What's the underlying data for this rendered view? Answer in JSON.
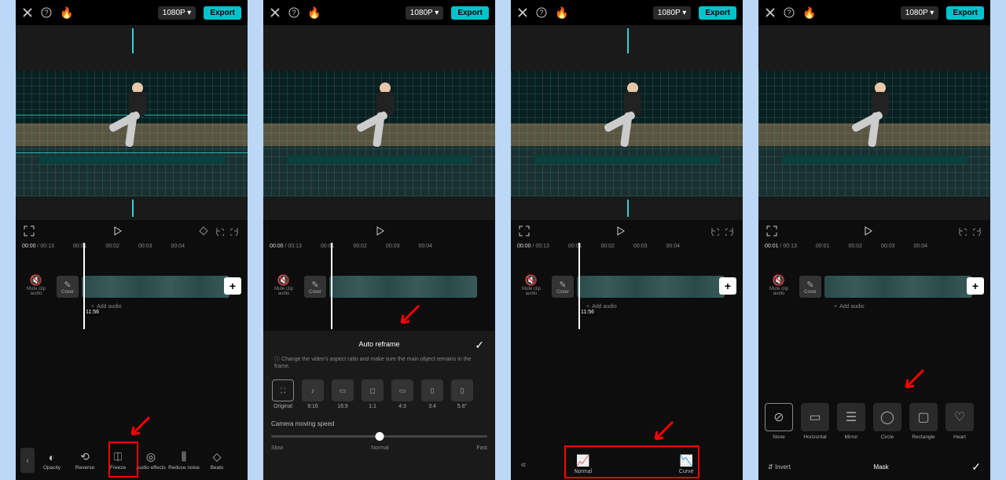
{
  "topbar": {
    "resolution": "1080P",
    "export": "Export"
  },
  "player": {
    "current1": "00:00",
    "current4": "00:01",
    "duration": "00:13"
  },
  "ruler": [
    "00:00",
    "00:01",
    "00:02",
    "00:03",
    "00:04"
  ],
  "clips": {
    "mute": "Mute clip audio",
    "cover": "Cover",
    "time": "11:56",
    "add_audio": "Add audio"
  },
  "tools1": [
    "Opacity",
    "Reverse",
    "Freeze",
    "Audio effects",
    "Reduce noise",
    "Beats"
  ],
  "panel2": {
    "title": "Auto reframe",
    "info": "Change the video's aspect ratio and make sure the main object remains in the frame.",
    "ratios": [
      "Original",
      "9:16",
      "16:9",
      "1:1",
      "4:3",
      "3:4",
      "5.8\""
    ],
    "cms": "Camera moving speed",
    "slow": "Slow",
    "normal": "Normal",
    "fast": "Fast"
  },
  "panel3": {
    "normal": "Normal",
    "curve": "Curve"
  },
  "panel4": {
    "masks": [
      "None",
      "Horizontal",
      "Mirror",
      "Circle",
      "Rectangle",
      "Heart"
    ],
    "invert": "Invert",
    "title": "Mask"
  }
}
